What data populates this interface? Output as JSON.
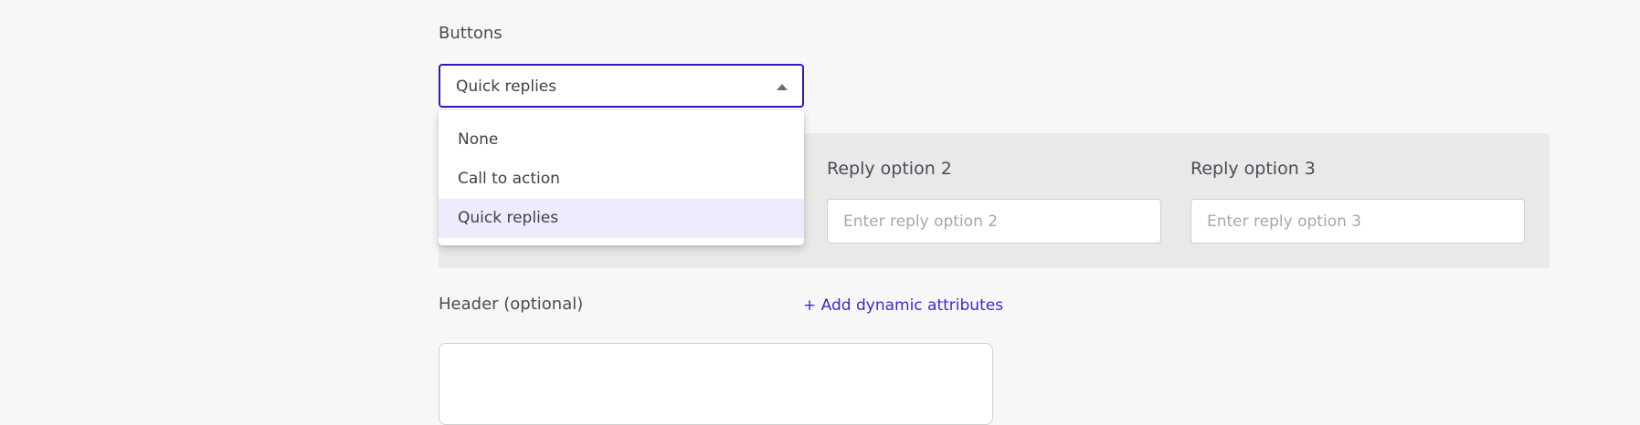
{
  "buttons": {
    "label": "Buttons",
    "selected_value": "Quick replies",
    "options": [
      "None",
      "Call to action",
      "Quick replies"
    ]
  },
  "replies": [
    {
      "label": "Reply option 2",
      "placeholder": "Enter reply option 2"
    },
    {
      "label": "Reply option 3",
      "placeholder": "Enter reply option 3"
    }
  ],
  "header": {
    "label": "Header (optional)",
    "add_link": "+ Add dynamic attributes"
  },
  "colors": {
    "accent": "#2d1cb8",
    "link": "#3a2bd1",
    "selected_option_bg": "#edebfd",
    "panel_bg": "#e9e9e9",
    "page_bg": "#f7f7f7"
  },
  "icons": {
    "select_caret": "caret-up-icon"
  }
}
